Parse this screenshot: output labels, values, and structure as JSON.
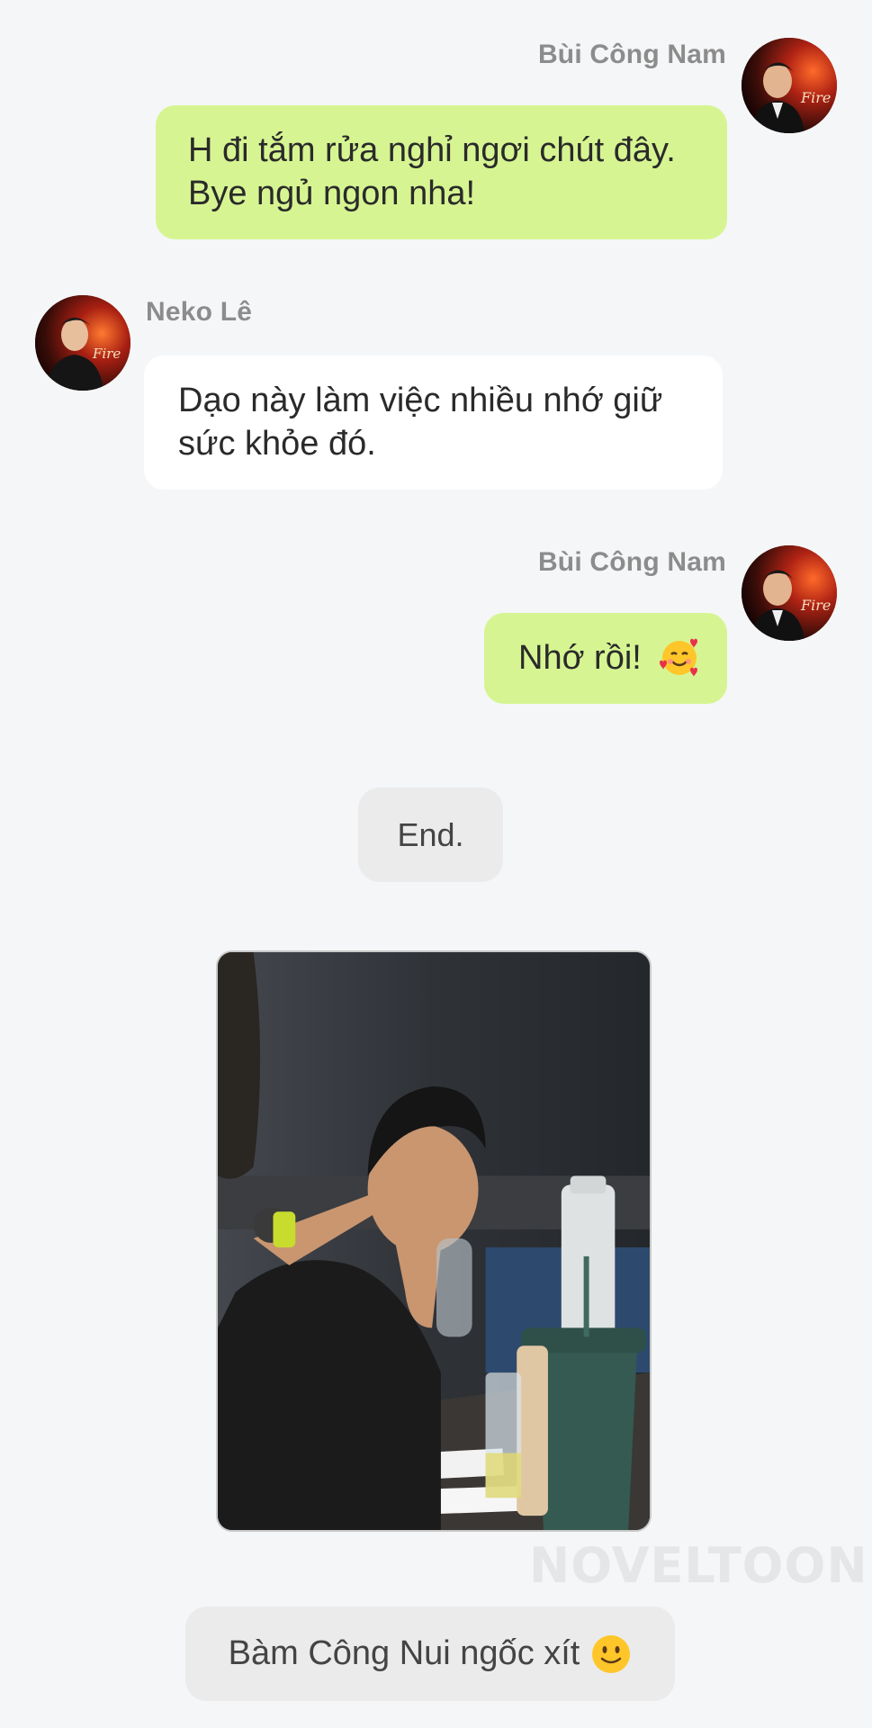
{
  "messages": [
    {
      "sender": "Bùi Công Nam",
      "side": "right",
      "lines": [
        "H đi tắm rửa nghỉ ngơi chút đây.",
        "Bye ngủ ngon nha!"
      ]
    },
    {
      "sender": "Neko Lê",
      "side": "left",
      "lines": [
        "Dạo này làm việc nhiều nhớ giữ",
        "sức khỏe đó."
      ]
    },
    {
      "sender": "Bùi Công Nam",
      "side": "right",
      "text": "Nhớ rồi!",
      "emoji": "smiling-face-with-hearts-icon"
    }
  ],
  "end_label": "End.",
  "caption": {
    "text": "Bàm Công Nui ngốc xít",
    "emoji": "slightly-smiling-face-icon"
  },
  "watermark": "NOVELTOON",
  "colors": {
    "outgoing_bubble": "#d6f592",
    "incoming_bubble": "#ffffff",
    "background": "#f5f6f8",
    "name_text": "#8c8c8c"
  }
}
